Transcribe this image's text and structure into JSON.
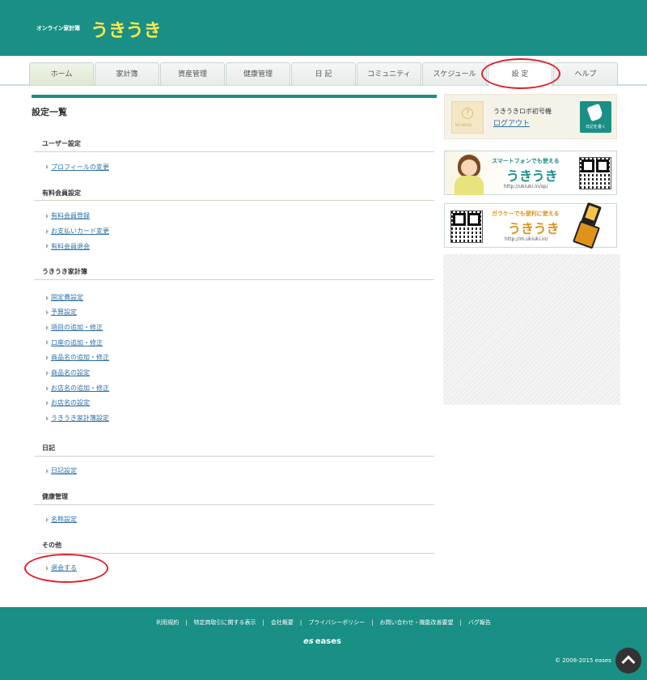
{
  "header": {
    "logo_sub": "オンライン家計簿",
    "logo_main": "うきうき"
  },
  "tabs": [
    {
      "label": "ホーム"
    },
    {
      "label": "家計簿"
    },
    {
      "label": "資産管理"
    },
    {
      "label": "健康管理"
    },
    {
      "label": "日 記"
    },
    {
      "label": "コミュニティ"
    },
    {
      "label": "スケジュール"
    },
    {
      "label": "設 定"
    },
    {
      "label": "ヘルプ"
    }
  ],
  "main": {
    "title": "設定一覧",
    "sections": [
      {
        "heading": "ユーザー設定",
        "links": [
          "プロフィールの変更"
        ]
      },
      {
        "heading": "有料会員設定",
        "links": [
          "有料会員登録",
          "お支払いカード変更",
          "有料会員退会"
        ]
      },
      {
        "heading": "うきうき家計簿",
        "links": [
          "固定費設定",
          "予算設定",
          "項目の追加・修正",
          "口座の追加・修正",
          "商品名の追加・修正",
          "商品名の設定",
          "お店名の追加・修正",
          "お店名の設定",
          "うきうき家計簿設定"
        ]
      },
      {
        "heading": "日記",
        "links": [
          "日記設定"
        ]
      },
      {
        "heading": "健康管理",
        "links": [
          "名称設定"
        ]
      },
      {
        "heading": "その他",
        "links": [
          "退会する"
        ]
      }
    ]
  },
  "sidebar": {
    "avatar_text": "NO IMAGE",
    "username": "うきうきロボ初号機",
    "logout": "ログアウト",
    "diary_button": "日記を書く",
    "banner_smartphone": {
      "title": "スマートフォンでも使える",
      "brand": "うきうき",
      "url": "http://ukiuki.in/sp/"
    },
    "banner_feature": {
      "title": "ガラケーでも便利に使える",
      "brand": "うきうき",
      "url": "http://m.ukiuki.in/"
    }
  },
  "footer": {
    "links": [
      "利用規約",
      "特定商取引に関する表示",
      "会社概要",
      "プライバシーポリシー",
      "お問い合わせ・機能改善要望",
      "バグ報告"
    ],
    "separator": "|",
    "logo_mark": "es",
    "logo_text": "eases",
    "copyright": "© 2008-2015 eases"
  },
  "colors": {
    "brand": "#1a8f85",
    "logo_yellow": "#ffe84a",
    "link": "#2c6fa8",
    "highlight_circle": "#e0202a"
  },
  "icons": {
    "to_top": "chevron-up-icon",
    "diary": "pen-icon",
    "avatar": "question-icon"
  }
}
